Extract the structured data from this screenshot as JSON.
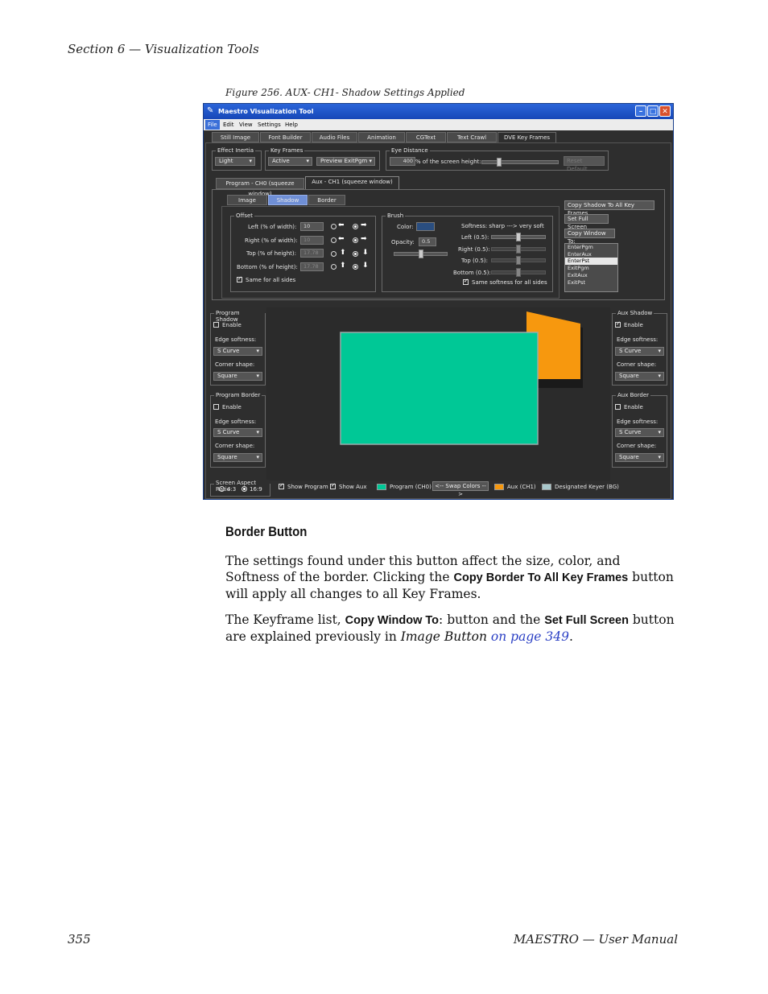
{
  "page": {
    "section_header": "Section 6 — Visualization Tools",
    "figure_caption": "Figure 256.  AUX- CH1- Shadow Settings Applied",
    "page_number": "355",
    "footer_title": "MAESTRO  —  User Manual"
  },
  "app": {
    "title": "Maestro Visualization Tool",
    "menu": [
      "File",
      "Edit",
      "View",
      "Settings",
      "Help"
    ],
    "main_tabs": [
      "Still Image",
      "Font Builder",
      "Audio Files",
      "Animation",
      "CGText",
      "Text Crawl",
      "DVE Key Frames"
    ],
    "effect_inertia": {
      "label": "Effect Inertia",
      "value": "Light"
    },
    "key_frames": {
      "label": "Key Frames",
      "value": "Active",
      "preview": "Preview ExitPgm"
    },
    "eye_distance": {
      "label": "Eye Distance",
      "value": "400",
      "suffix": "% of the screen height:",
      "reset": "Reset Default"
    },
    "channel_tabs": [
      "Program - CH0 (squeeze window)",
      "Aux - CH1 (squeeze window)"
    ],
    "sub_tabs": [
      "Image",
      "Shadow",
      "Border"
    ],
    "offset": {
      "label": "Offset",
      "rows": [
        {
          "label": "Left (% of width):",
          "value": "10"
        },
        {
          "label": "Right (% of width):",
          "value": "10"
        },
        {
          "label": "Top (% of height):",
          "value": "17.78"
        },
        {
          "label": "Bottom (% of height):",
          "value": "17.78"
        }
      ],
      "same_all": "Same for all sides"
    },
    "brush": {
      "label": "Brush",
      "color_label": "Color:",
      "opacity_label": "Opacity:",
      "opacity_value": "0.5",
      "softness_label": "Softness:  sharp ---> very soft",
      "rows": [
        "Left (0.5):",
        "Right (0.5):",
        "Top (0.5):",
        "Bottom (0.5):"
      ],
      "same_softness": "Same softness for all sides"
    },
    "right_buttons": [
      "Copy Shadow To All Key Frames",
      "Set Full Screen",
      "Copy Window To:"
    ],
    "keyframe_list": [
      "EnterPgm",
      "EnterAux",
      "EnterPst",
      "ExitPgm",
      "ExitAux",
      "ExitPst"
    ],
    "keyframe_selected": 2,
    "program_shadow": {
      "label": "Program Shadow",
      "enable": "Enable",
      "edge_label": "Edge softness:",
      "edge": "S Curve",
      "corner_label": "Corner shape:",
      "corner": "Square"
    },
    "program_border": {
      "label": "Program Border",
      "enable": "Enable",
      "edge_label": "Edge softness:",
      "edge": "S Curve",
      "corner_label": "Corner shape:",
      "corner": "Square"
    },
    "aux_shadow": {
      "label": "Aux Shadow",
      "enable": "Enable",
      "edge_label": "Edge softness:",
      "edge": "S Curve",
      "corner_label": "Corner shape:",
      "corner": "Square"
    },
    "aux_border": {
      "label": "Aux Border",
      "enable": "Enable",
      "edge_label": "Edge softness:",
      "edge": "S Curve",
      "corner_label": "Corner shape:",
      "corner": "Square"
    },
    "bottom": {
      "aspect_label": "Screen Aspect Ratio",
      "ratio_43": "4:3",
      "ratio_169": "16:9",
      "show_program": "Show Program",
      "show_aux": "Show Aux",
      "program_ch": "Program (CH0)",
      "swap": "<-- Swap Colors -->",
      "aux_ch": "Aux (CH1)",
      "keyer": "Designated Keyer (BG)"
    },
    "colors": {
      "program": "#00c896",
      "aux": "#f7980e",
      "keyer": "#a8c8cc"
    }
  },
  "body": {
    "heading": "Border Button",
    "p1_a": "The settings found under this button affect the size, color, and Softness of the border. Clicking the ",
    "p1_b": "Copy Border To All Key Frames",
    "p1_c": " button will apply all changes to all Key Frames.",
    "p2_a": "The Keyframe list, ",
    "p2_b": "Copy Window To",
    "p2_c": ": button and the ",
    "p2_d": "Set Full Screen",
    "p2_e": " button are explained previously in ",
    "p2_f": "Image Button",
    "p2_g": " ",
    "p2_link": "on page 349",
    "p2_h": "."
  }
}
